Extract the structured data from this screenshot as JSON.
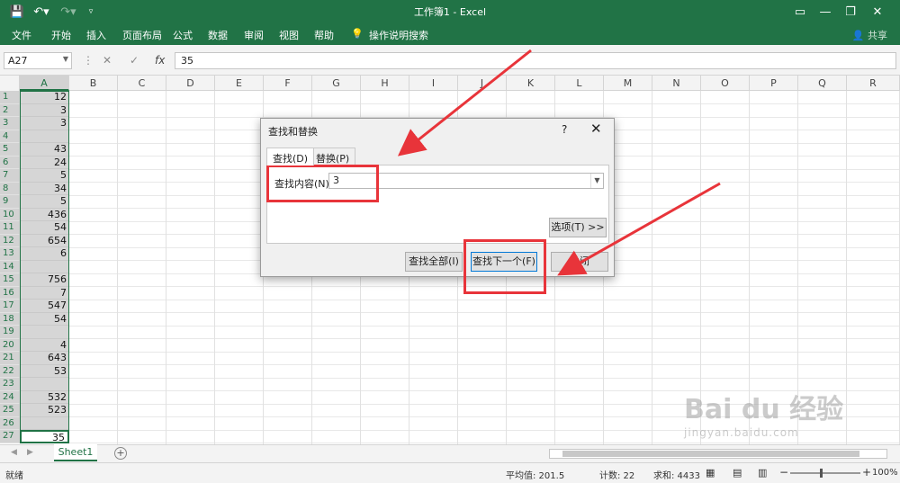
{
  "titlebar": {
    "title": "工作簿1  -  Excel",
    "quick_access": [
      "save-icon",
      "undo-icon",
      "redo-icon",
      "customize-icon"
    ],
    "window_buttons": [
      "minimize-icon",
      "restore-icon",
      "close-icon"
    ]
  },
  "ribbon": {
    "tabs": [
      "文件",
      "开始",
      "插入",
      "页面布局",
      "公式",
      "数据",
      "审阅",
      "视图",
      "帮助"
    ],
    "tell_me": "操作说明搜索",
    "share": "共享"
  },
  "formula_bar": {
    "name_box": "A27",
    "formula": "35",
    "cancel_icon": "✕",
    "enter_icon": "✓",
    "fx_icon": "fx"
  },
  "grid": {
    "columns": [
      "A",
      "B",
      "C",
      "D",
      "E",
      "F",
      "G",
      "H",
      "I",
      "J",
      "K",
      "L",
      "M",
      "N",
      "O",
      "P",
      "Q",
      "R"
    ],
    "rows": [
      "1",
      "2",
      "3",
      "4",
      "5",
      "6",
      "7",
      "8",
      "9",
      "10",
      "11",
      "12",
      "13",
      "14",
      "15",
      "16",
      "17",
      "18",
      "19",
      "20",
      "21",
      "22",
      "23",
      "24",
      "25",
      "26",
      "27"
    ],
    "column_a": [
      "12",
      "3",
      "3",
      "",
      "43",
      "24",
      "5",
      "34",
      "5",
      "436",
      "54",
      "654",
      "6",
      "",
      "756",
      "7",
      "547",
      "54",
      "",
      "4",
      "643",
      "53",
      "",
      "532",
      "523",
      "",
      "35"
    ],
    "active_cell": "A27"
  },
  "sheets": {
    "tabs": [
      "Sheet1"
    ],
    "add": "+"
  },
  "status": {
    "ready": "就绪",
    "average": "平均值: 201.5",
    "count": "计数: 22",
    "sum": "求和: 4433",
    "zoom": "100%",
    "zoom_minus": "−",
    "zoom_plus": "+"
  },
  "dialog": {
    "title": "查找和替换",
    "help": "?",
    "close": "✕",
    "tabs": [
      "查找(D)",
      "替换(P)"
    ],
    "find_label": "查找内容(N):",
    "find_value": "3",
    "options_button": "选项(T) >>",
    "find_all_button": "查找全部(I)",
    "find_next_button": "查找下一个(F)",
    "close_button": "关闭"
  },
  "watermark": {
    "brand": "Bai du 经验",
    "url": "jingyan.baidu.com"
  },
  "colors": {
    "excel_green": "#217346",
    "annotation_red": "#e8343a"
  }
}
